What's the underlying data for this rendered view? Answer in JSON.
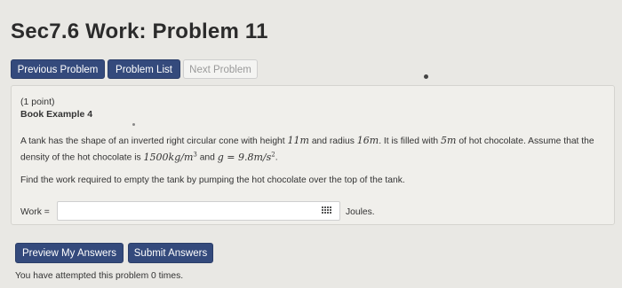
{
  "page": {
    "title": "Sec7.6 Work: Problem 11"
  },
  "nav": {
    "previous_label": "Previous Problem",
    "list_label": "Problem List",
    "next_label": "Next Problem"
  },
  "problem": {
    "points": "(1 point)",
    "source": "Book Example 4",
    "text_1": "A tank has the shape of an inverted right circular cone with height ",
    "height": "11m",
    "text_2": " and radius ",
    "radius": "16m",
    "text_3": ". It is filled with ",
    "depth": "5m",
    "text_4": " of hot chocolate. Assume that the density of the hot chocolate is ",
    "density": "1500kg/m",
    "density_exp": "3",
    "text_5": " and ",
    "gravity": "g = 9.8m/s",
    "gravity_exp": "2",
    "text_6": ".",
    "question": "Find the work required to empty the tank by pumping the hot chocolate over the top of the tank."
  },
  "answer": {
    "label": "Work =",
    "value": "",
    "units": "Joules."
  },
  "actions": {
    "preview_label": "Preview My Answers",
    "submit_label": "Submit Answers"
  },
  "status": {
    "attempts": "You have attempted this problem 0 times."
  },
  "colors": {
    "primary": "#344a7c",
    "background": "#e9e8e4"
  }
}
